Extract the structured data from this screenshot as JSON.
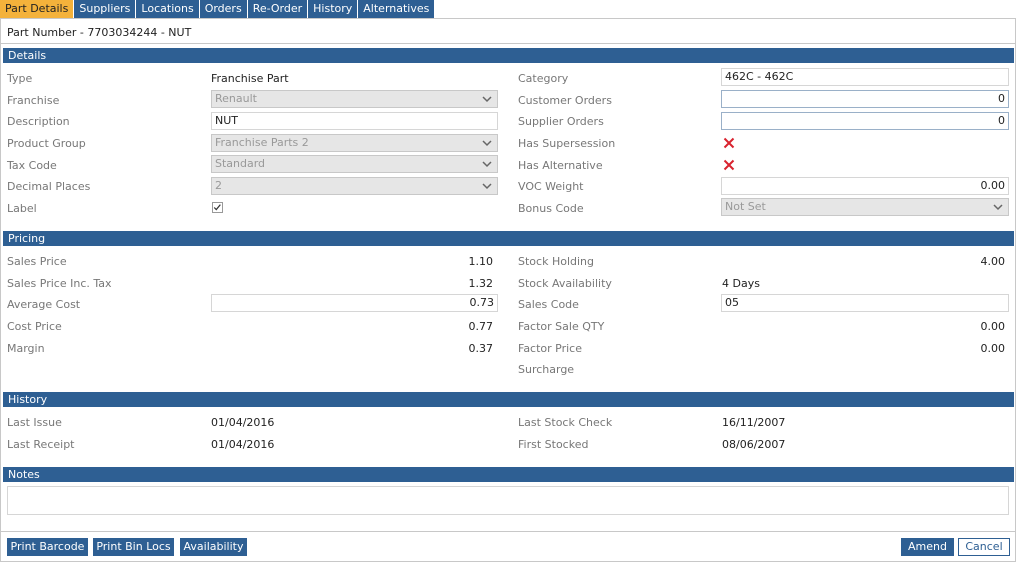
{
  "tabs": [
    "Part Details",
    "Suppliers",
    "Locations",
    "Orders",
    "Re-Order",
    "History",
    "Alternatives"
  ],
  "part_title": "Part Number - 7703034244 - NUT",
  "sections": {
    "details": "Details",
    "pricing": "Pricing",
    "history": "History",
    "notes": "Notes"
  },
  "details": {
    "type_label": "Type",
    "type_value": "Franchise Part",
    "franchise_label": "Franchise",
    "franchise_value": "Renault",
    "description_label": "Description",
    "description_value": "NUT",
    "product_group_label": "Product Group",
    "product_group_value": "Franchise Parts 2",
    "tax_code_label": "Tax Code",
    "tax_code_value": "Standard",
    "decimal_places_label": "Decimal Places",
    "decimal_places_value": "2",
    "label_label": "Label",
    "label_checked": true,
    "category_label": "Category",
    "category_value": "462C - 462C",
    "customer_orders_label": "Customer Orders",
    "customer_orders_value": "0",
    "supplier_orders_label": "Supplier Orders",
    "supplier_orders_value": "0",
    "has_supersession_label": "Has Supersession",
    "has_supersession": false,
    "has_alternative_label": "Has Alternative",
    "has_alternative": false,
    "voc_weight_label": "VOC Weight",
    "voc_weight_value": "0.00",
    "bonus_code_label": "Bonus Code",
    "bonus_code_value": "Not Set"
  },
  "pricing": {
    "sales_price_label": "Sales Price",
    "sales_price_value": "1.10",
    "sales_price_inc_tax_label": "Sales Price Inc. Tax",
    "sales_price_inc_tax_value": "1.32",
    "average_cost_label": "Average Cost",
    "average_cost_value": "0.73",
    "cost_price_label": "Cost Price",
    "cost_price_value": "0.77",
    "margin_label": "Margin",
    "margin_value": "0.37",
    "stock_holding_label": "Stock Holding",
    "stock_holding_value": "4.00",
    "stock_availability_label": "Stock Availability",
    "stock_availability_value": "4 Days",
    "sales_code_label": "Sales Code",
    "sales_code_value": "05",
    "factor_sale_qty_label": "Factor Sale QTY",
    "factor_sale_qty_value": "0.00",
    "factor_price_label": "Factor Price",
    "factor_price_value": "0.00",
    "surcharge_label": "Surcharge"
  },
  "history": {
    "last_issue_label": "Last Issue",
    "last_issue_value": "01/04/2016",
    "last_receipt_label": "Last Receipt",
    "last_receipt_value": "01/04/2016",
    "last_stock_check_label": "Last Stock Check",
    "last_stock_check_value": "16/11/2007",
    "first_stocked_label": "First Stocked",
    "first_stocked_value": "08/06/2007"
  },
  "buttons": {
    "print_barcode": "Print Barcode",
    "print_bin_locs": "Print Bin Locs",
    "availability": "Availability",
    "amend": "Amend",
    "cancel": "Cancel"
  },
  "colors": {
    "header_blue": "#2e5f93",
    "active_tab": "#f4b23b",
    "cross_red": "#d9232e"
  },
  "icons": {
    "cross": "close-icon",
    "chevron": "chevron-down-icon",
    "check": "check-icon"
  }
}
